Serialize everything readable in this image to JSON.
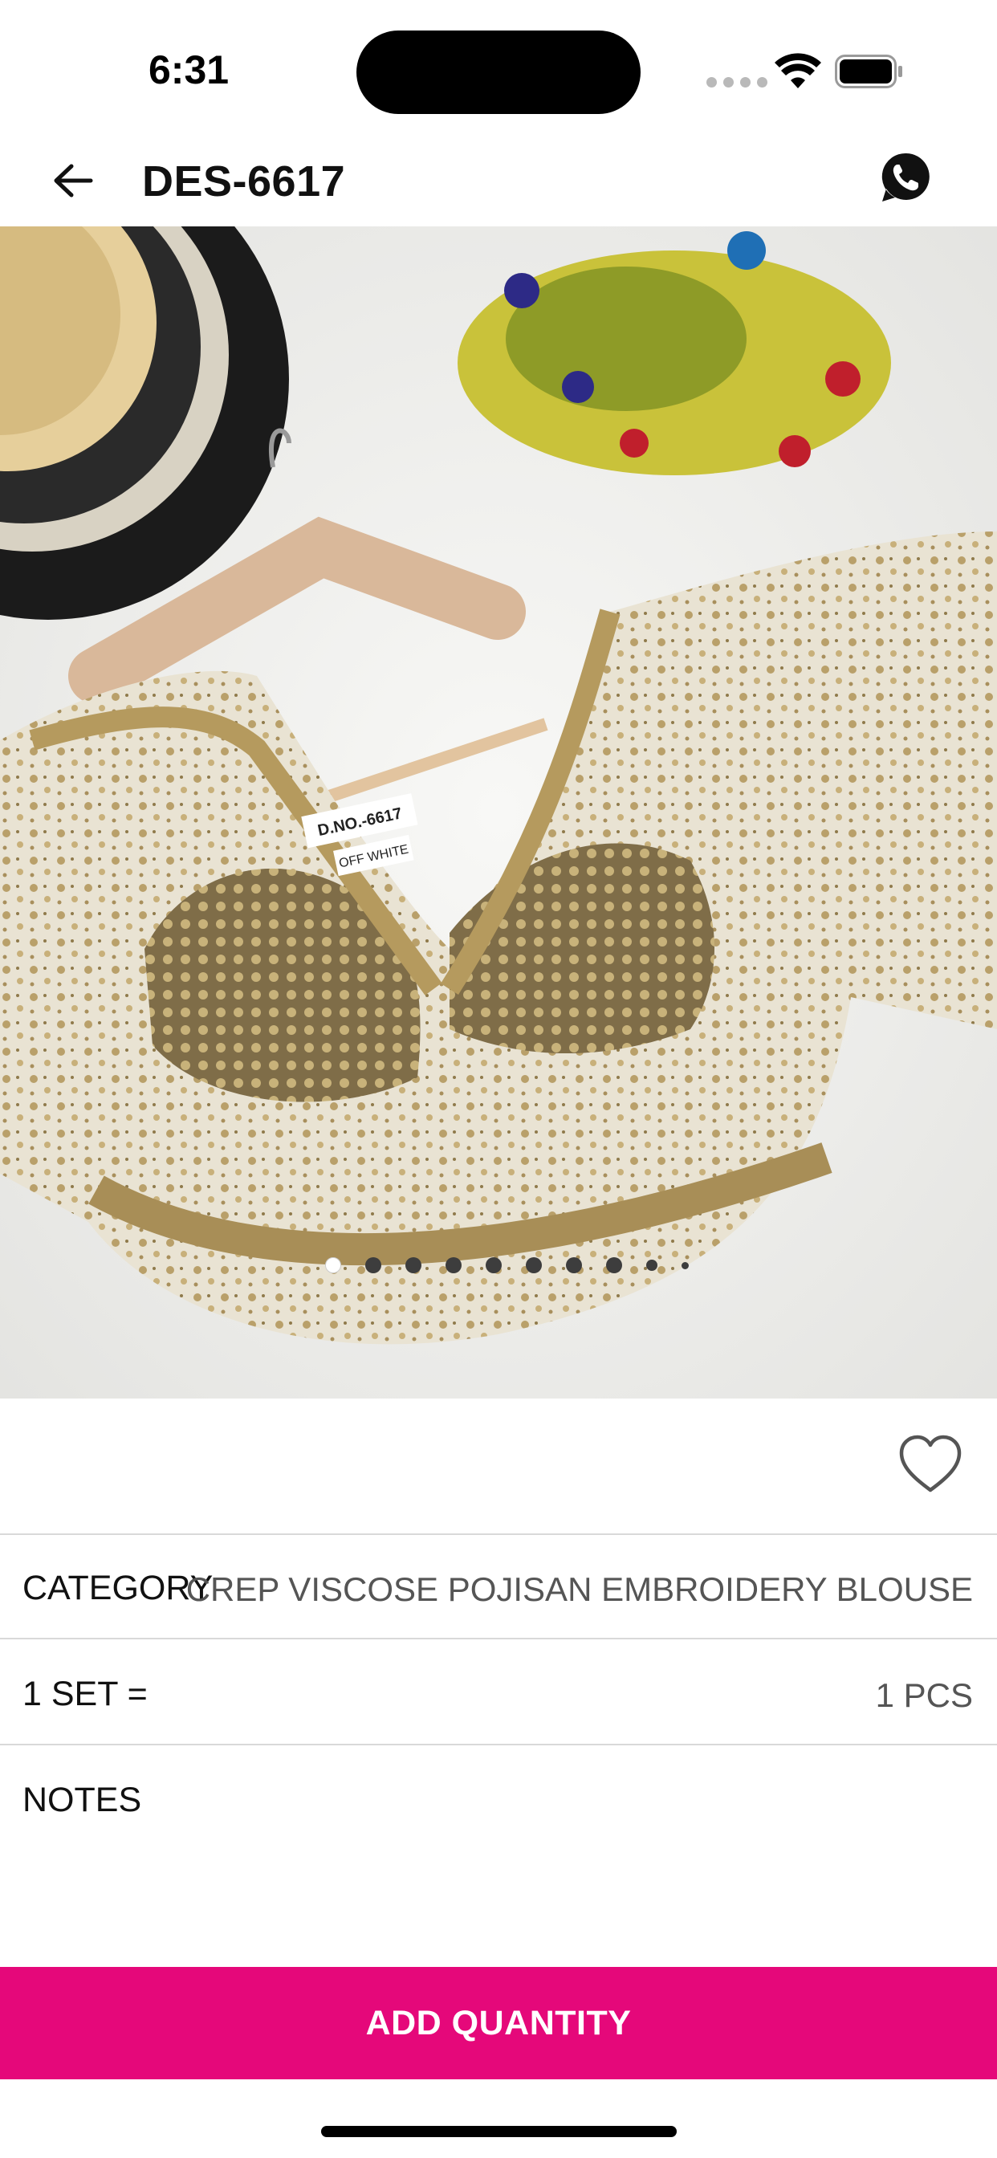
{
  "status_bar": {
    "time": "6:31"
  },
  "nav": {
    "title": "DES-6617",
    "back_icon": "arrow-left-icon",
    "whatsapp_icon": "whatsapp-icon"
  },
  "product_image": {
    "label_line1": "D.NO.-6617",
    "label_line2": "OFF WHITE",
    "pager": {
      "total": 10,
      "active_index": 0
    }
  },
  "favorite": {
    "icon": "heart-outline-icon"
  },
  "details": {
    "category_label": "CATEGORY",
    "category_value": "CREP VISCOSE POJISAN EMBROIDERY BLOUSE",
    "set_label": "1 SET =",
    "set_value": "1 PCS",
    "notes_label": "NOTES"
  },
  "actions": {
    "add_quantity_label": "ADD QUANTITY"
  },
  "colors": {
    "accent": "#e5087a",
    "divider": "#d9d9d9",
    "value_text": "#555555"
  }
}
